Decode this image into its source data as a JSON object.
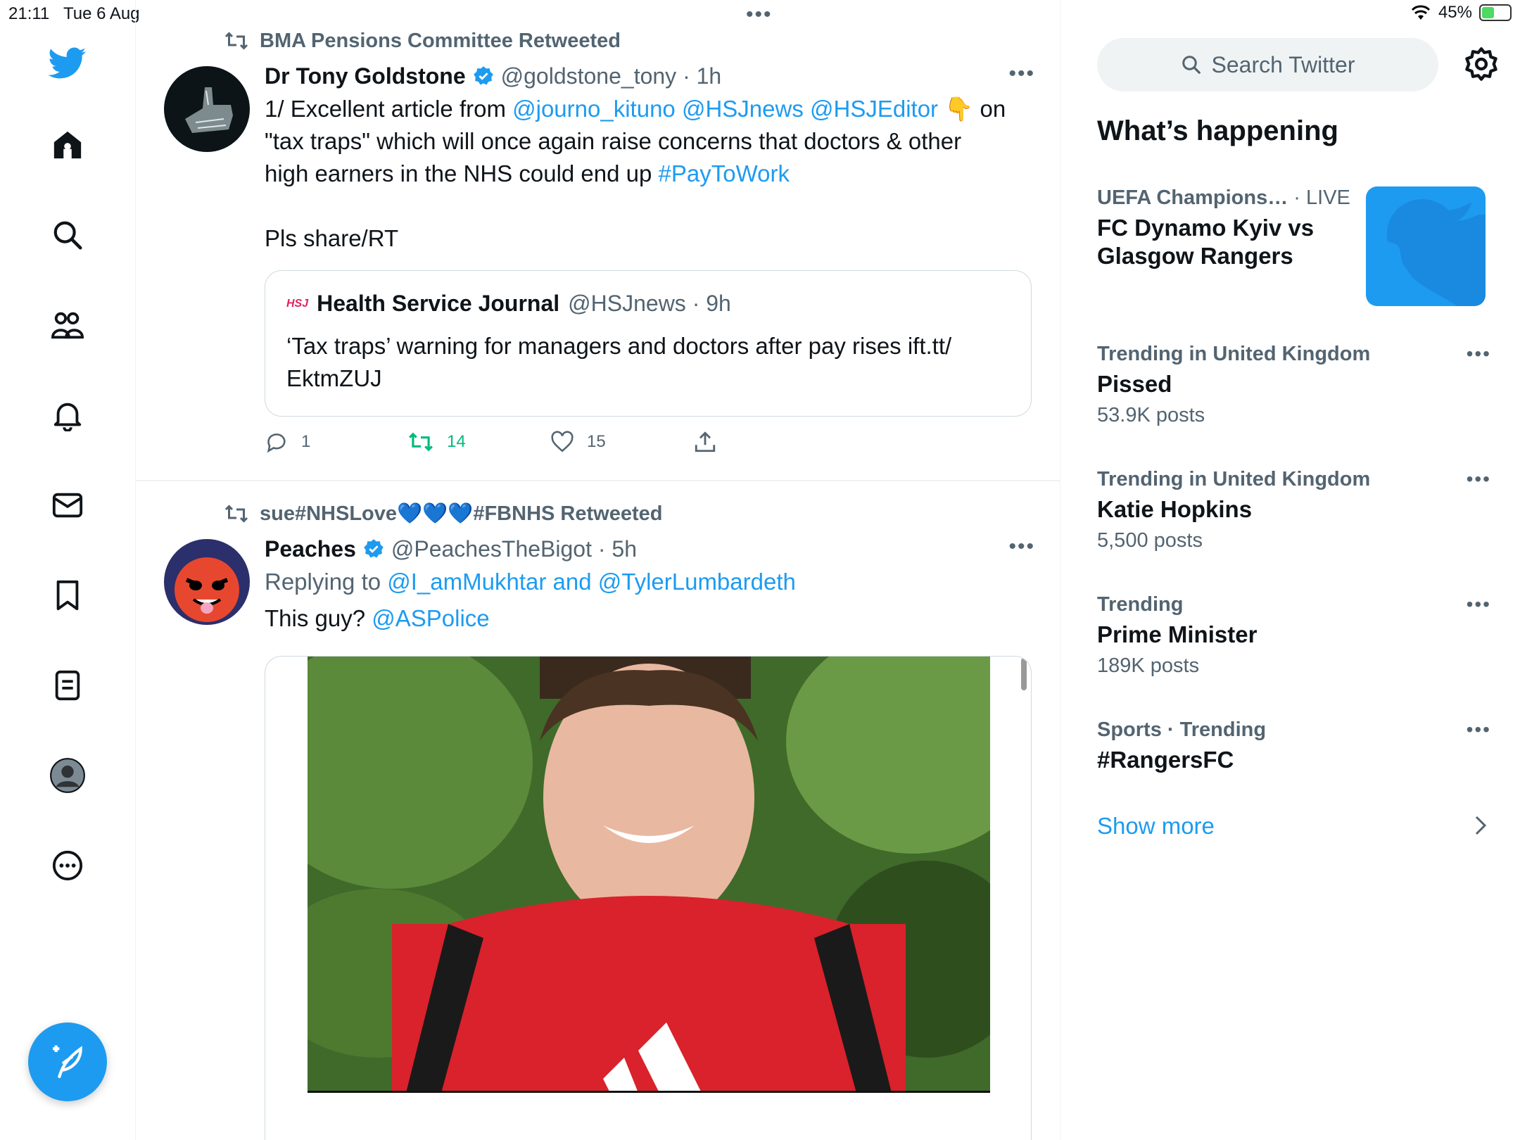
{
  "status_bar": {
    "time": "21:11",
    "date": "Tue 6 Aug",
    "battery": "45%",
    "battery_level": 0.45,
    "dots": "•••"
  },
  "nav": {
    "items": [
      "twitter-logo",
      "home",
      "explore",
      "communities",
      "notifications",
      "messages",
      "bookmarks",
      "lists",
      "profile",
      "more"
    ]
  },
  "tweets": [
    {
      "retweeted_by": "BMA Pensions Committee Retweeted",
      "name": "Dr Tony Goldstone",
      "handle": "@goldstone_tony · 1h",
      "more": "•••",
      "text_lines": [
        {
          "t1": "1/ Excellent article from ",
          "l1": "@journo_kituno @HSJnews @HSJEditor",
          "t2": " 👇 on"
        },
        {
          "t1": "\"tax traps\" which will once again raise concerns that doctors & other"
        },
        {
          "t1": "high earners in the NHS could end up ",
          "l1": "#PayToWork"
        }
      ],
      "text_extra": "Pls share/RT",
      "quote": {
        "logo": "HSJ",
        "name": "Health Service Journal",
        "handle": "@HSJnews · 9h",
        "text_line1": "‘Tax traps’ warning for managers and doctors after pay rises ift.tt/",
        "text_line2": "EktmZUJ"
      },
      "actions": {
        "replies": "1",
        "retweets": "14",
        "likes": "15"
      }
    },
    {
      "retweeted_by": "sue#NHSLove💙💙💙#FBNHS Retweeted",
      "name": "Peaches",
      "handle": "@PeachesTheBigot · 5h",
      "more": "•••",
      "replying_prefix": "Replying to ",
      "replying_to": "@I_amMukhtar and @TylerLumbardeth",
      "text": "This guy? ",
      "text_link": "@ASPolice"
    }
  ],
  "sidebar": {
    "search_placeholder": "Search Twitter",
    "heading": "What’s happening",
    "featured": {
      "meta": "UEFA Champions…",
      "live": " · LIVE",
      "title": "FC Dynamo Kyiv vs Glasgow Rangers"
    },
    "trends": [
      {
        "meta": "Trending in United Kingdom",
        "title": "Pissed",
        "count": "53.9K posts"
      },
      {
        "meta": "Trending in United Kingdom",
        "title": "Katie Hopkins",
        "count": "5,500 posts"
      },
      {
        "meta": "Trending",
        "title": "Prime Minister",
        "count": "189K posts"
      },
      {
        "meta": "Sports · Trending",
        "title": "#RangersFC",
        "count": ""
      }
    ],
    "trend_more": "•••",
    "show_more": "Show more"
  }
}
